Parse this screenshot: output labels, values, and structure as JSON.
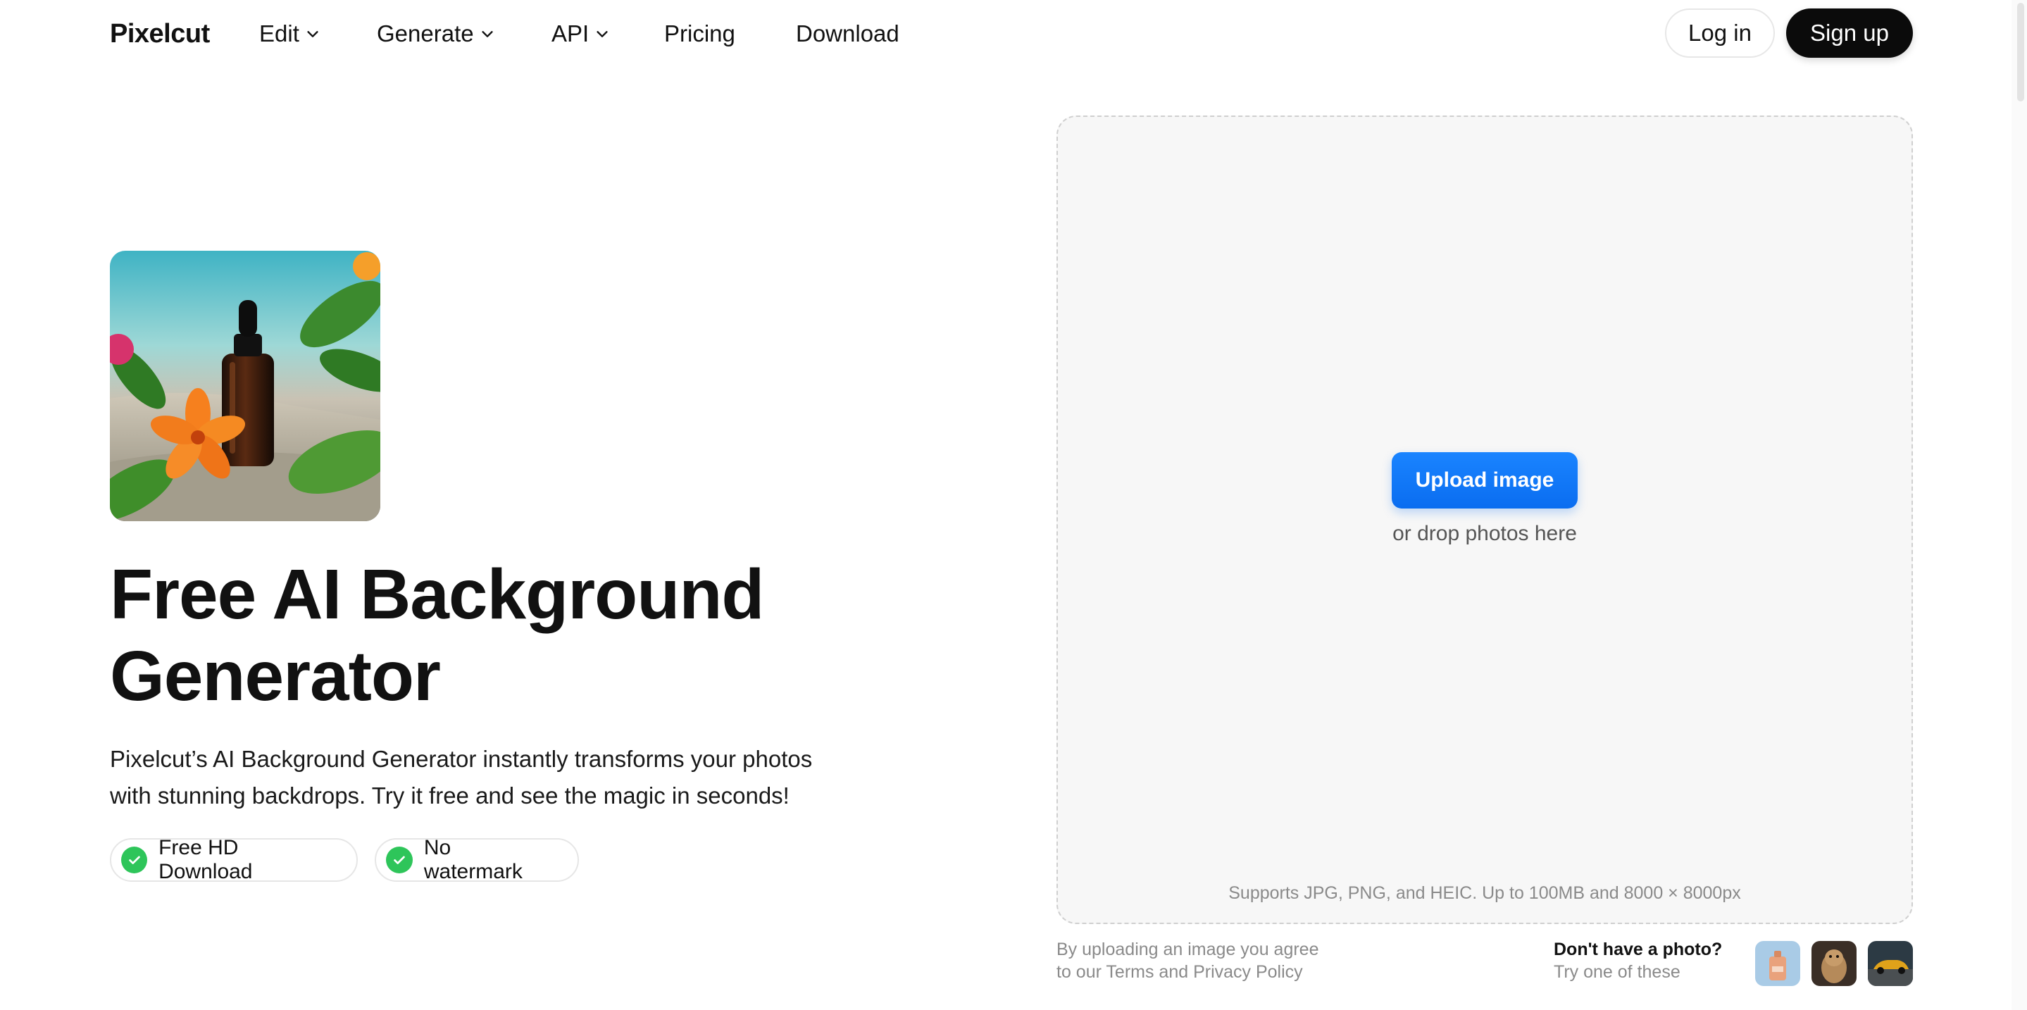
{
  "nav": {
    "logo": "Pixelcut",
    "items": [
      {
        "label": "Edit",
        "dropdown": true
      },
      {
        "label": "Generate",
        "dropdown": true
      },
      {
        "label": "API",
        "dropdown": true
      },
      {
        "label": "Pricing",
        "dropdown": false
      },
      {
        "label": "Download",
        "dropdown": false
      }
    ],
    "login": "Log in",
    "signup": "Sign up"
  },
  "hero": {
    "title_line1": "Free AI Background",
    "title_line2": "Generator",
    "description_line1": "Pixelcut’s AI Background Generator instantly transforms your photos",
    "description_line2": "with stunning backdrops. Try it free and see the magic in seconds!",
    "badges": [
      "Free HD Download",
      "No watermark"
    ]
  },
  "upload": {
    "button": "Upload image",
    "drop_text": "or drop photos here",
    "supports": "Supports JPG, PNG, and HEIC. Up to 100MB and 8000 × 8000px",
    "legal_line1": "By uploading an image you agree",
    "legal_line2": "to our Terms and Privacy Policy",
    "sample_title": "Don't have a photo?",
    "sample_sub": "Try one of these"
  },
  "colors": {
    "accent": "#0a6df0",
    "check_green": "#2ec55a",
    "signup_bg": "#0b0b0b"
  }
}
